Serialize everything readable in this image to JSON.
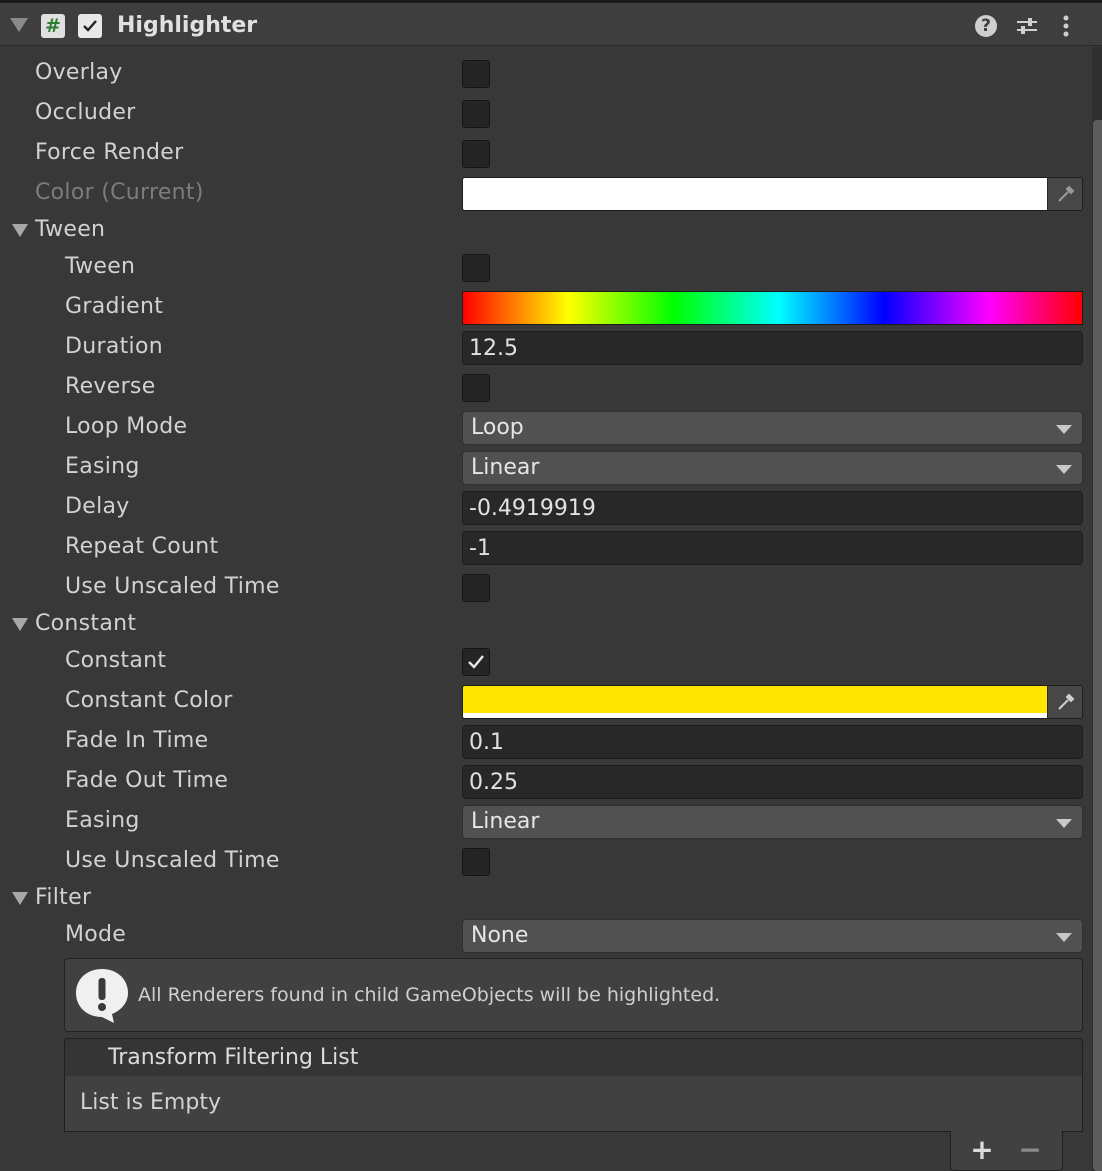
{
  "header": {
    "title": "Highlighter",
    "script_icon_glyph": "#",
    "enabled": true
  },
  "fields": {
    "overlay": {
      "label": "Overlay",
      "checked": false
    },
    "occluder": {
      "label": "Occluder",
      "checked": false
    },
    "force_render": {
      "label": "Force Render",
      "checked": false
    },
    "color_current": {
      "label": "Color (Current)",
      "color": "#ffffff"
    }
  },
  "tween": {
    "section_label": "Tween",
    "tween": {
      "label": "Tween",
      "checked": false
    },
    "gradient": {
      "label": "Gradient"
    },
    "duration": {
      "label": "Duration",
      "value": "12.5"
    },
    "reverse": {
      "label": "Reverse",
      "checked": false
    },
    "loop_mode": {
      "label": "Loop Mode",
      "value": "Loop"
    },
    "easing": {
      "label": "Easing",
      "value": "Linear"
    },
    "delay": {
      "label": "Delay",
      "value": "-0.4919919"
    },
    "repeat_count": {
      "label": "Repeat Count",
      "value": "-1"
    },
    "use_unscaled_time": {
      "label": "Use Unscaled Time",
      "checked": false
    }
  },
  "constant": {
    "section_label": "Constant",
    "constant": {
      "label": "Constant",
      "checked": true
    },
    "constant_color": {
      "label": "Constant Color",
      "color": "#ffe600"
    },
    "fade_in_time": {
      "label": "Fade In Time",
      "value": "0.1"
    },
    "fade_out_time": {
      "label": "Fade Out Time",
      "value": "0.25"
    },
    "easing": {
      "label": "Easing",
      "value": "Linear"
    },
    "use_unscaled_time": {
      "label": "Use Unscaled Time",
      "checked": false
    }
  },
  "filter": {
    "section_label": "Filter",
    "mode": {
      "label": "Mode",
      "value": "None"
    },
    "help_message": "All Renderers found in child GameObjects will be highlighted.",
    "list_title": "Transform Filtering List",
    "list_empty": "List is Empty",
    "add_glyph": "+",
    "remove_glyph": "−"
  }
}
